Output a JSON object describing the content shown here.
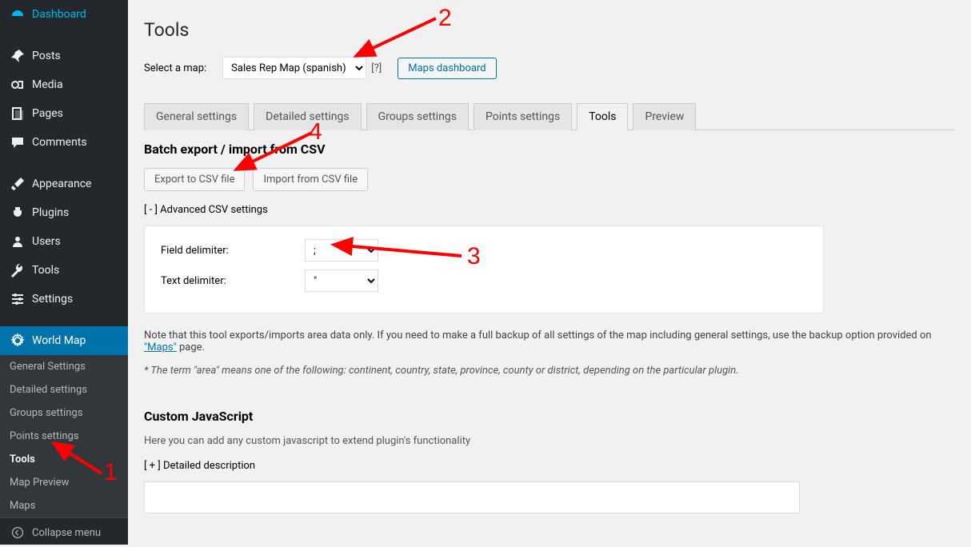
{
  "sidebar": {
    "items": [
      {
        "label": "Dashboard",
        "icon": "dashboard"
      },
      {
        "label": "Posts",
        "icon": "pin"
      },
      {
        "label": "Media",
        "icon": "media"
      },
      {
        "label": "Pages",
        "icon": "pages"
      },
      {
        "label": "Comments",
        "icon": "comment"
      },
      {
        "label": "Appearance",
        "icon": "brush"
      },
      {
        "label": "Plugins",
        "icon": "plug"
      },
      {
        "label": "Users",
        "icon": "user"
      },
      {
        "label": "Tools",
        "icon": "wrench"
      },
      {
        "label": "Settings",
        "icon": "sliders"
      },
      {
        "label": "World Map",
        "icon": "gear"
      }
    ],
    "submenu": [
      "General Settings",
      "Detailed settings",
      "Groups settings",
      "Points settings",
      "Tools",
      "Map Preview",
      "Maps"
    ],
    "collapse": "Collapse menu"
  },
  "page": {
    "title": "Tools",
    "select_label": "Select a map:",
    "selected_map": "Sales Rep Map (spanish)",
    "help": "[?]",
    "maps_dashboard": "Maps dashboard",
    "tabs": [
      "General settings",
      "Detailed settings",
      "Groups settings",
      "Points settings",
      "Tools",
      "Preview"
    ],
    "active_tab": 4,
    "batch_title": "Batch export / import from CSV",
    "export_btn": "Export to CSV file",
    "import_btn": "Import from CSV file",
    "adv_toggle": "[ - ]  Advanced CSV settings",
    "field_delim_label": "Field delimiter:",
    "field_delim_value": ";",
    "text_delim_label": "Text delimiter:",
    "text_delim_value": "\"",
    "note_pre": "Note that this tool exports/imports area data only. If you need to make a full backup of all settings of the map including general settings, use the backup option provided on ",
    "note_link": "\"Maps\"",
    "note_post": " page.",
    "asterisk": "* The term \"area\" means one of the following: continent, country, state, province, county or district, depending on the particular plugin.",
    "custom_js_title": "Custom JavaScript",
    "custom_js_desc": "Here you can add any custom javascript to extend plugin's functionality",
    "detailed_toggle": "[ + ]  Detailed description"
  },
  "annotations": {
    "n1": "1",
    "n2": "2",
    "n3": "3",
    "n4": "4"
  }
}
